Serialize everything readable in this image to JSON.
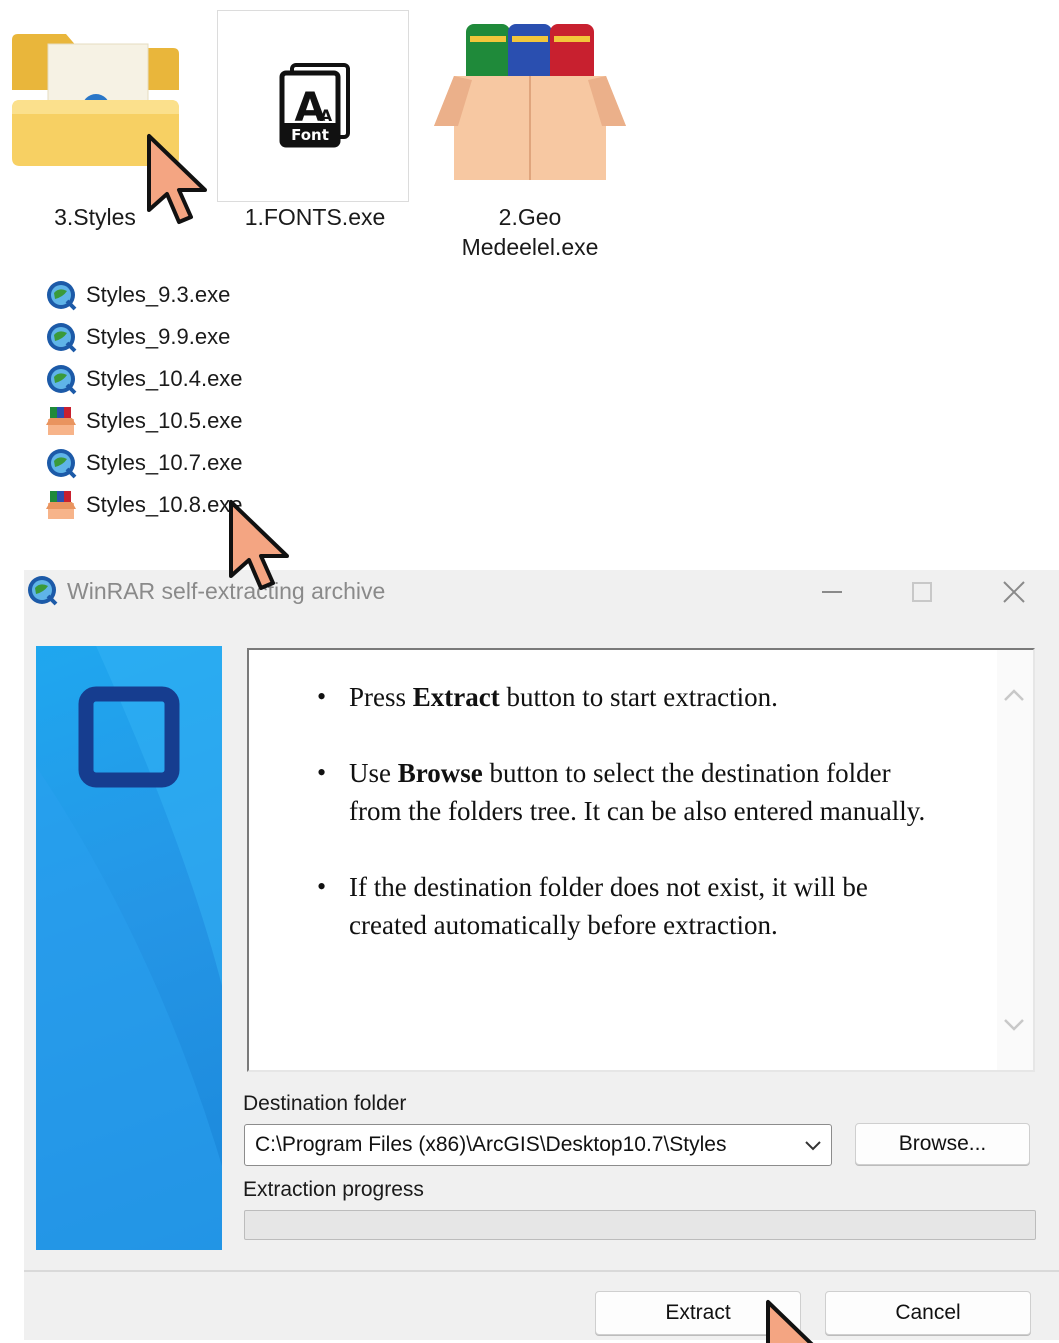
{
  "explorer": {
    "big_items": [
      {
        "label": "3.Styles",
        "icon": "folder-icon"
      },
      {
        "label": "1.FONTS.exe",
        "icon": "font-file-icon",
        "icon_text": "Font"
      },
      {
        "label_line1": "2.Geo",
        "label_line2": "Medeelel.exe",
        "icon": "winrar-archive-icon"
      }
    ],
    "list_items": [
      {
        "label": "Styles_9.3.exe",
        "icon": "globe-installer-icon"
      },
      {
        "label": "Styles_9.9.exe",
        "icon": "globe-installer-icon"
      },
      {
        "label": "Styles_10.4.exe",
        "icon": "globe-installer-icon"
      },
      {
        "label": "Styles_10.5.exe",
        "icon": "winrar-archive-icon"
      },
      {
        "label": "Styles_10.7.exe",
        "icon": "globe-installer-icon"
      },
      {
        "label": "Styles_10.8.exe",
        "icon": "winrar-archive-icon"
      }
    ]
  },
  "dialog": {
    "title": "WinRAR self-extracting archive",
    "instructions": {
      "item1_pre": "Press ",
      "item1_bold": "Extract",
      "item1_post": " button to start extraction.",
      "item2_pre": "Use ",
      "item2_bold": "Browse",
      "item2_post": " button to select the destination folder from the folders tree. It can be also entered manually.",
      "item3": "If the destination folder does not exist, it will be created automatically before extraction."
    },
    "destination_label": "Destination folder",
    "destination_value": "C:\\Program Files (x86)\\ArcGIS\\Desktop10.7\\Styles",
    "browse_label": "Browse...",
    "progress_label": "Extraction progress",
    "progress_value": 0,
    "extract_label": "Extract",
    "cancel_label": "Cancel"
  },
  "colors": {
    "cursor_fill": "#f4a582",
    "banner_blue": "#1fa7ef",
    "banner_square": "#163d8f"
  }
}
